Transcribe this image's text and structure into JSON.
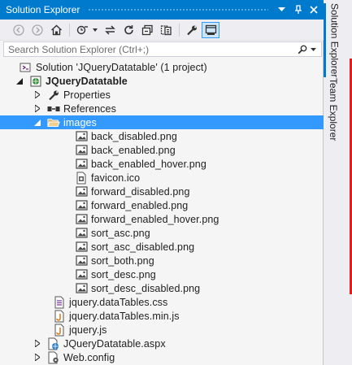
{
  "window": {
    "title": "Solution Explorer"
  },
  "search": {
    "placeholder": "Search Solution Explorer (Ctrl+;)"
  },
  "tree": {
    "solution": "Solution 'JQueryDatatable' (1 project)",
    "project": "JQueryDatatable",
    "properties": "Properties",
    "references": "References",
    "images_folder": "images",
    "images": [
      "back_disabled.png",
      "back_enabled.png",
      "back_enabled_hover.png",
      "favicon.ico",
      "forward_disabled.png",
      "forward_enabled.png",
      "forward_enabled_hover.png",
      "sort_asc.png",
      "sort_asc_disabled.png",
      "sort_both.png",
      "sort_desc.png",
      "sort_desc_disabled.png"
    ],
    "css_file": "jquery.dataTables.css",
    "js_min_file": "jquery.dataTables.min.js",
    "js_file": "jquery.js",
    "aspx_file": "JQueryDatatable.aspx",
    "config_file": "Web.config"
  },
  "side_tabs": {
    "solution_explorer": "Solution Explorer",
    "team_explorer": "Team Explorer"
  },
  "colors": {
    "accent": "#007acc",
    "selection": "#3399ff",
    "panel": "#f5f5f5"
  }
}
